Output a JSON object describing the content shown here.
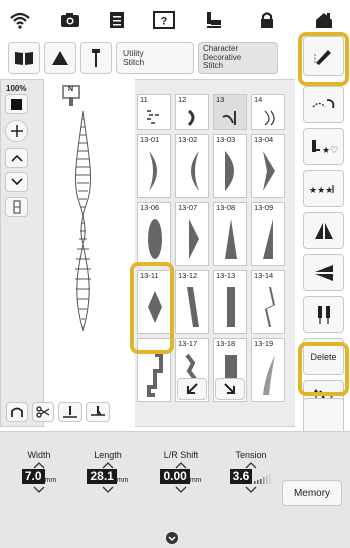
{
  "top_icons": [
    "wifi-icon",
    "camera-icon",
    "document-icon",
    "help-icon",
    "thread-icon",
    "lock-icon",
    "home-icon"
  ],
  "categories": {
    "utility": "Utility\nStitch",
    "character": "Character\nDecorative\nStitch"
  },
  "zoom": "100%",
  "presser_foot_label": "N",
  "stitches": {
    "row0": [
      "11",
      "12",
      "13",
      "14"
    ],
    "row1": [
      "13-01",
      "13-02",
      "13-03",
      "13-04"
    ],
    "row2": [
      "13-06",
      "13-07",
      "13-08",
      "13-09"
    ],
    "row3": [
      "13-11",
      "13-12",
      "13-13",
      "13-14"
    ],
    "row4": [
      "",
      "13-17",
      "13-18",
      "13-19"
    ]
  },
  "side": {
    "delete": "Delete",
    "count": "4"
  },
  "controls": {
    "width": {
      "label": "Width",
      "value": "7.0",
      "unit": "mm"
    },
    "length": {
      "label": "Length",
      "value": "28.1",
      "unit": "mm"
    },
    "shift": {
      "label": "L/R Shift",
      "value": "0.00",
      "unit": "mm"
    },
    "tension": {
      "label": "Tension",
      "value": "3.6"
    }
  },
  "memory": "Memory",
  "colors": {
    "highlight": "#e2b32d",
    "panel": "#e9e9e9",
    "value_bg": "#1a1a1a"
  }
}
